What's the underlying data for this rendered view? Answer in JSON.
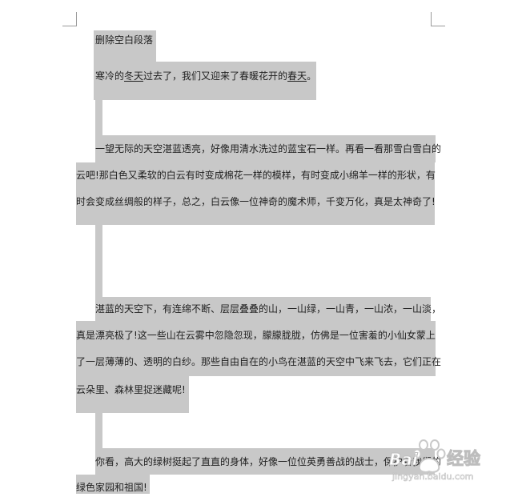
{
  "document": {
    "heading": "删除空白段落",
    "para1": {
      "a": "寒冷的",
      "b": "冬天",
      "c": "过去了，我们又迎来了春暖花开的",
      "d": "春天",
      "e": "。"
    },
    "para2": [
      "一望无际的天空湛蓝透亮，好像用清水洗过的蓝宝石一样。再看一看那雪白雪白的",
      "云吧!那白色又柔软的白云有时变成棉花一样的模样，有时变成小绵羊一样的形状，有",
      "时会变成丝绸般的样子，总之，白云像一位神奇的魔术师，千变万化，真是太神奇了!"
    ],
    "para3": [
      "湛蓝的天空下，有连绵不断、层层叠叠的山，一山绿，一山青，一山浓，一山淡，",
      "真是漂亮极了!这一些山在云雾中忽隐忽现，朦朦胧胧，仿佛是一位害羞的小仙女蒙上",
      "了一层薄薄的、透明的白纱。那些自由自在的小鸟在湛蓝的天空中飞来飞去，它们正在",
      "云朵里、森林里捉迷藏呢!"
    ],
    "para4": [
      "你看，高大的绿树挺起了直直的身体，好像一位位英勇善战的战士，保护着我们的",
      "绿色家园和祖国!"
    ]
  },
  "watermark": {
    "logo_text": "Bai",
    "brand_cn": "经验",
    "site": "jingyan.baidu.com"
  }
}
